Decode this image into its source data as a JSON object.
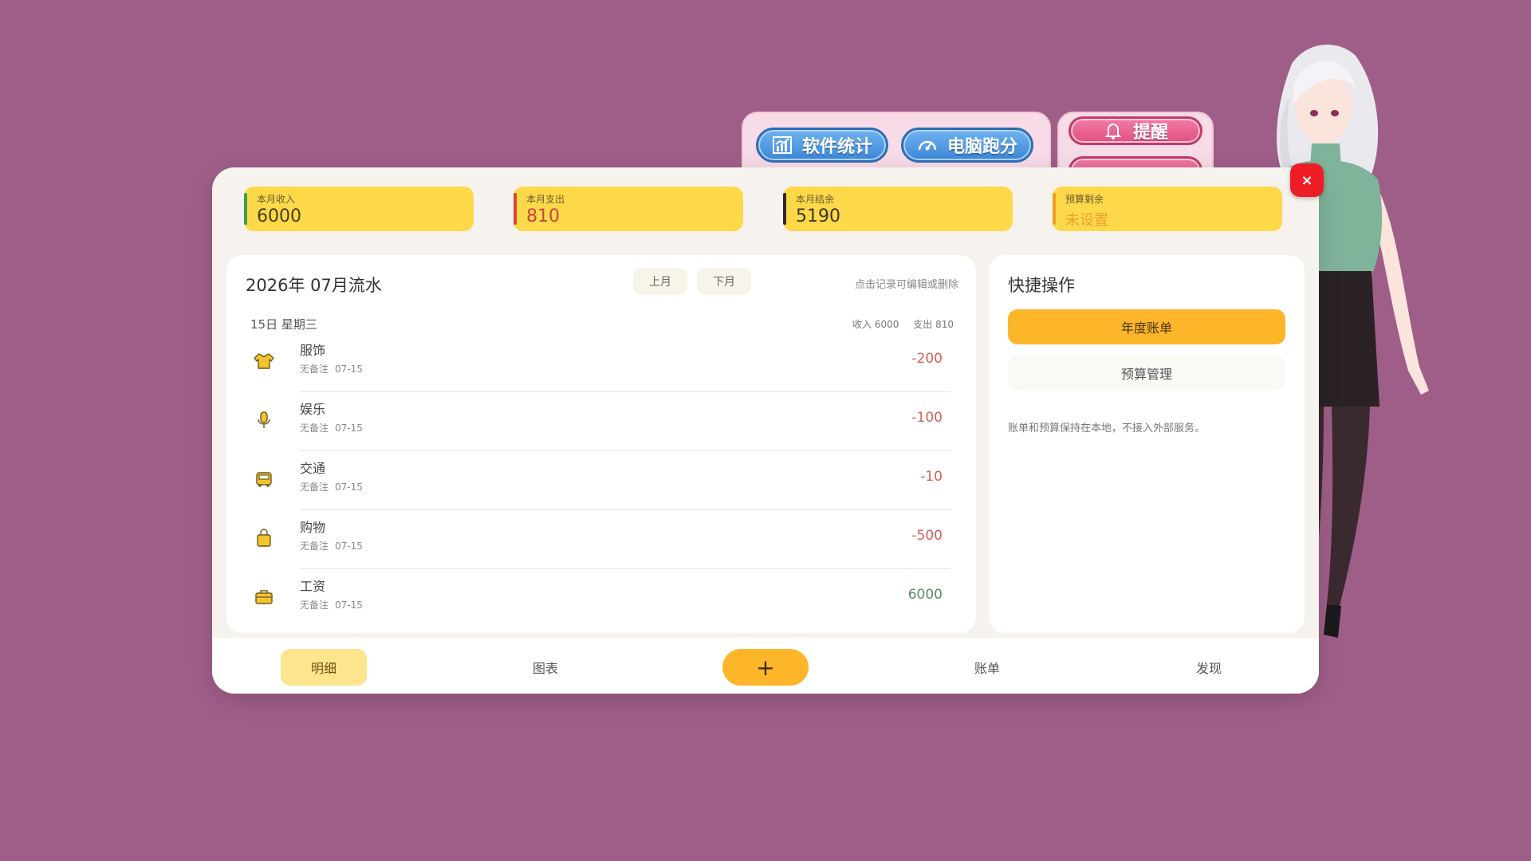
{
  "top_tabs": {
    "software_stats": "软件统计",
    "pc_benchmark": "电脑跑分",
    "reminder": "提醒"
  },
  "summary": [
    {
      "label": "本月收入",
      "value": "6000",
      "accent": "#3aa04a",
      "value_color": "#4a3e12"
    },
    {
      "label": "本月支出",
      "value": "810",
      "accent": "#d8453c",
      "value_color": "#c8463f"
    },
    {
      "label": "本月结余",
      "value": "5190",
      "accent": "#2b2b2b",
      "value_color": "#3d3520"
    },
    {
      "label": "预算剩余",
      "value": "未设置",
      "accent": "#f0a020",
      "value_color": "#f0a030"
    }
  ],
  "ledger": {
    "title": "2026年 07月流水",
    "prev_month": "上月",
    "next_month": "下月",
    "hint": "点击记录可编辑或删除",
    "day": {
      "label": "15日 星期三",
      "income": "收入 6000",
      "expense": "支出 810"
    },
    "entries": [
      {
        "category": "服饰",
        "note": "无备注",
        "date": "07-15",
        "amount": "-200",
        "icon": "shirt-icon"
      },
      {
        "category": "娱乐",
        "note": "无备注",
        "date": "07-15",
        "amount": "-100",
        "icon": "microphone-icon"
      },
      {
        "category": "交通",
        "note": "无备注",
        "date": "07-15",
        "amount": "-10",
        "icon": "bus-icon"
      },
      {
        "category": "购物",
        "note": "无备注",
        "date": "07-15",
        "amount": "-500",
        "icon": "shopping-bag-icon"
      },
      {
        "category": "工资",
        "note": "无备注",
        "date": "07-15",
        "amount": "6000",
        "icon": "briefcase-icon"
      }
    ]
  },
  "quick": {
    "title": "快捷操作",
    "annual_bill": "年度账单",
    "budget_manage": "预算管理",
    "note": "账单和预算保持在本地，不接入外部服务。"
  },
  "nav": {
    "detail": "明细",
    "chart": "图表",
    "add": "+",
    "bill": "账单",
    "discover": "发现"
  },
  "close_label": "×",
  "colors": {
    "background": "#9f5e88",
    "accent_yellow": "#fdd94a",
    "accent_orange": "#fdb52a",
    "expense_red": "#d0615b",
    "income_green": "#5b8a6a"
  }
}
